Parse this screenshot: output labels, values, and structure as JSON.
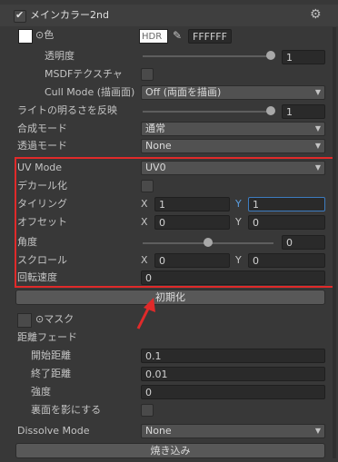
{
  "header": {
    "title": "メインカラー2nd",
    "gear": "gear-icon"
  },
  "color": {
    "label": "⊙色",
    "hdr": "HDR",
    "hex": "FFFFFF"
  },
  "opacity": {
    "label": "透明度",
    "value": "1",
    "level": 1.0
  },
  "msdf": {
    "label": "MSDFテクスチャ"
  },
  "cull": {
    "label": "Cull Mode (描画面)",
    "value": "Off (両面を描画)"
  },
  "light": {
    "label": "ライトの明るさを反映",
    "value": "1",
    "level": 1.0
  },
  "blend": {
    "label": "合成モード",
    "value": "通常"
  },
  "transparent": {
    "label": "透過モード",
    "value": "None"
  },
  "uv": {
    "label": "UV Mode",
    "value": "UV0"
  },
  "decal": {
    "label": "デカール化"
  },
  "tiling": {
    "label": "タイリング",
    "x_label": "X",
    "x": "1",
    "y_label": "Y",
    "y": "1"
  },
  "offset": {
    "label": "オフセット",
    "x_label": "X",
    "x": "0",
    "y_label": "Y",
    "y": "0"
  },
  "angle": {
    "label": "角度",
    "value": "0",
    "level": 0.5
  },
  "scroll": {
    "label": "スクロール",
    "x_label": "X",
    "x": "0",
    "y_label": "Y",
    "y": "0"
  },
  "rotation": {
    "label": "回転速度",
    "value": "0"
  },
  "reset_button": "初期化",
  "mask": {
    "label": "⊙マスク"
  },
  "distance_fade": {
    "label": "距離フェード"
  },
  "fade_start": {
    "label": "開始距離",
    "value": "0.1"
  },
  "fade_end": {
    "label": "終了距離",
    "value": "0.01"
  },
  "strength": {
    "label": "強度",
    "value": "0"
  },
  "backface": {
    "label": "裏面を影にする"
  },
  "dissolve": {
    "label": "Dissolve Mode",
    "value": "None"
  },
  "bake_button": "焼き込み",
  "colors": {
    "highlight": "#e02a2a",
    "accent": "#3d7cc0"
  }
}
